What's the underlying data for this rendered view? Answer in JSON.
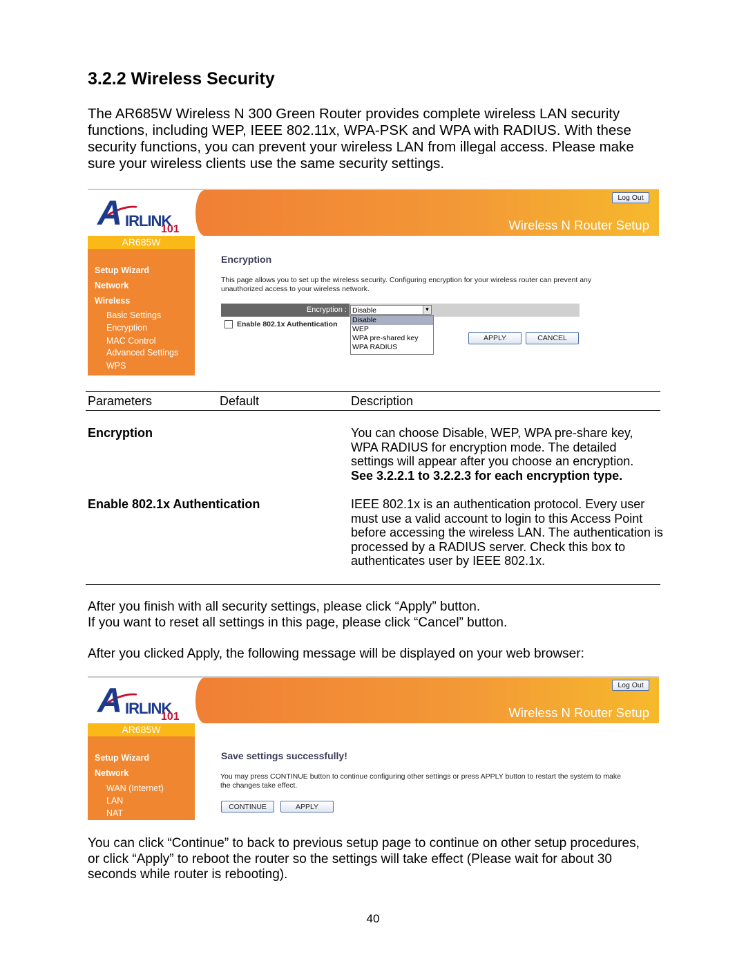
{
  "heading": "3.2.2 Wireless Security",
  "intro": [
    "The AR685W Wireless N 300 Green Router provides complete wireless LAN security",
    "functions, including WEP, IEEE 802.11x, WPA-PSK and WPA with RADIUS. With these",
    "security functions, you can prevent your wireless LAN from illegal access. Please make",
    "sure your wireless clients use the same security settings."
  ],
  "router": {
    "brand": "AIRLINK 101",
    "logout": "Log Out",
    "banner_title": "Wireless N Router Setup",
    "model": "AR685W",
    "colors": {
      "sidebar": "#f0862f",
      "model_band": "#fbb917",
      "heading": "#3a3a58"
    }
  },
  "shot1": {
    "sidebar": [
      {
        "label": "Setup Wizard",
        "level": "main"
      },
      {
        "label": "Network",
        "level": "main"
      },
      {
        "label": "Wireless",
        "level": "main"
      },
      {
        "label": "Basic Settings",
        "level": "sub"
      },
      {
        "label": "Encryption",
        "level": "sub"
      },
      {
        "label": "MAC Control",
        "level": "sub"
      },
      {
        "label": "Advanced Settings",
        "level": "sub"
      },
      {
        "label": "WPS",
        "level": "sub"
      }
    ],
    "title": "Encryption",
    "description": [
      "This page allows you to set up the wireless security. Configuring encryption for your wireless router can prevent any",
      "unauthorized access to your wireless network."
    ],
    "encryption_label": "Encryption :",
    "encryption_value": "Disable",
    "options": [
      "Disable",
      "WEP",
      "WPA pre-shared key",
      "WPA RADIUS"
    ],
    "checkbox_label": "Enable 802.1x Authentication",
    "checkbox_checked": false,
    "apply": "APPLY",
    "cancel": "CANCEL"
  },
  "table": {
    "headers": [
      "Parameters",
      "Default",
      "Description"
    ],
    "rows": [
      {
        "param": "Encryption",
        "default": "",
        "desc": [
          "You can choose Disable, WEP, WPA pre-share key,",
          "WPA RADIUS for encryption mode. The detailed",
          "settings will appear after you choose an encryption."
        ],
        "desc_bold": "See 3.2.2.1 to 3.2.2.3 for each encryption type."
      },
      {
        "param": "Enable 802.1x Authentication",
        "default": "",
        "desc": [
          "IEEE 802.1x is an authentication protocol. Every user",
          "must use a valid account to login to this Access Point",
          "before accessing the wireless LAN. The authentication is",
          "processed by a RADIUS server. Check this box to",
          "authenticates user by IEEE 802.1x."
        ]
      }
    ]
  },
  "after1": [
    "After you finish with all security settings, please click “Apply” button.",
    "If you want to reset all settings in this page, please click “Cancel” button."
  ],
  "after2": "After you clicked Apply, the following message will be displayed on your web browser:",
  "shot2": {
    "sidebar": [
      {
        "label": "Setup Wizard",
        "level": "main"
      },
      {
        "label": "Network",
        "level": "main"
      },
      {
        "label": "WAN (Internet)",
        "level": "sub"
      },
      {
        "label": "LAN",
        "level": "sub"
      },
      {
        "label": "NAT",
        "level": "sub"
      }
    ],
    "title": "Save settings successfully!",
    "description": [
      "You may press CONTINUE button to continue configuring other settings or press APPLY button to restart the system to make",
      "the changes take effect."
    ],
    "continue": "CONTINUE",
    "apply": "APPLY"
  },
  "closing": [
    "You can click “Continue” to back to previous setup page to continue on other setup procedures,",
    "or click “Apply” to reboot the router so the settings will take effect (Please wait for about 30",
    "seconds while router is rebooting)."
  ],
  "page_number": "40"
}
